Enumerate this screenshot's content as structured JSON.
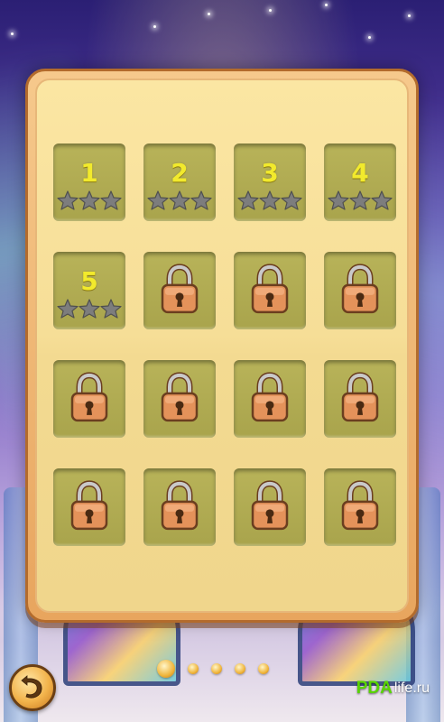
{
  "levels": [
    {
      "number": "1",
      "locked": false,
      "stars": 0
    },
    {
      "number": "2",
      "locked": false,
      "stars": 0
    },
    {
      "number": "3",
      "locked": false,
      "stars": 0
    },
    {
      "number": "4",
      "locked": false,
      "stars": 0
    },
    {
      "number": "5",
      "locked": false,
      "stars": 0
    },
    {
      "number": "",
      "locked": true,
      "stars": 0
    },
    {
      "number": "",
      "locked": true,
      "stars": 0
    },
    {
      "number": "",
      "locked": true,
      "stars": 0
    },
    {
      "number": "",
      "locked": true,
      "stars": 0
    },
    {
      "number": "",
      "locked": true,
      "stars": 0
    },
    {
      "number": "",
      "locked": true,
      "stars": 0
    },
    {
      "number": "",
      "locked": true,
      "stars": 0
    },
    {
      "number": "",
      "locked": true,
      "stars": 0
    },
    {
      "number": "",
      "locked": true,
      "stars": 0
    },
    {
      "number": "",
      "locked": true,
      "stars": 0
    },
    {
      "number": "",
      "locked": true,
      "stars": 0
    }
  ],
  "stars_per_level": 3,
  "pagination": {
    "total_pages": 5,
    "current_page": 1
  },
  "watermark": {
    "logo": "PDA",
    "text": "life.ru"
  },
  "colors": {
    "panel_fill": "#fbe6a3",
    "panel_border": "#b36b2c",
    "tile_fill": "#b8b359",
    "level_number": "#f2ea2c",
    "star_empty": "#7d7d7d",
    "lock_body": "#e4925a"
  },
  "icons": {
    "back": "back-arrow-icon",
    "lock": "padlock-icon",
    "star": "star-icon"
  }
}
